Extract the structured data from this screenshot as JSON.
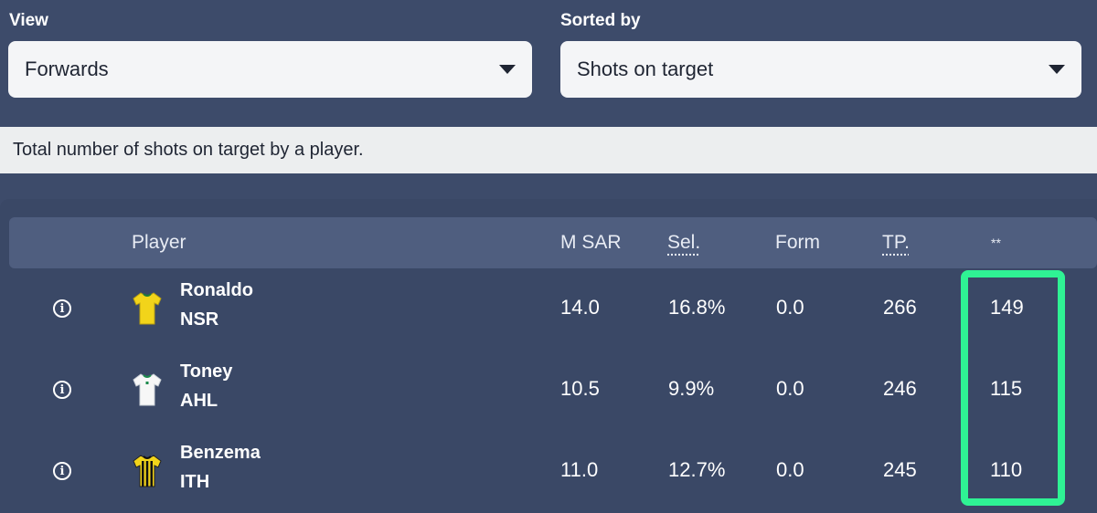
{
  "view": {
    "label": "View",
    "value": "Forwards"
  },
  "sort": {
    "label": "Sorted by",
    "value": "Shots on target"
  },
  "description": "Total number of shots on target by a player.",
  "table": {
    "headers": {
      "player": "Player",
      "msar": "M SAR",
      "sel": "Sel.",
      "form": "Form",
      "tp": "TP.",
      "stat": "**"
    },
    "rows": [
      {
        "name": "Ronaldo",
        "team": "NSR",
        "kit_icon": "yellow-shirt-icon",
        "msar": "14.0",
        "sel": "16.8%",
        "form": "0.0",
        "tp": "266",
        "stat": "149"
      },
      {
        "name": "Toney",
        "team": "AHL",
        "kit_icon": "white-green-shirt-icon",
        "msar": "10.5",
        "sel": "9.9%",
        "form": "0.0",
        "tp": "246",
        "stat": "115"
      },
      {
        "name": "Benzema",
        "team": "ITH",
        "kit_icon": "yellow-black-striped-shirt-icon",
        "msar": "11.0",
        "sel": "12.7%",
        "form": "0.0",
        "tp": "245",
        "stat": "110"
      }
    ]
  },
  "colors": {
    "background": "#3d4b6a",
    "header_row": "#4f5e7f",
    "highlight": "#2ff294"
  }
}
